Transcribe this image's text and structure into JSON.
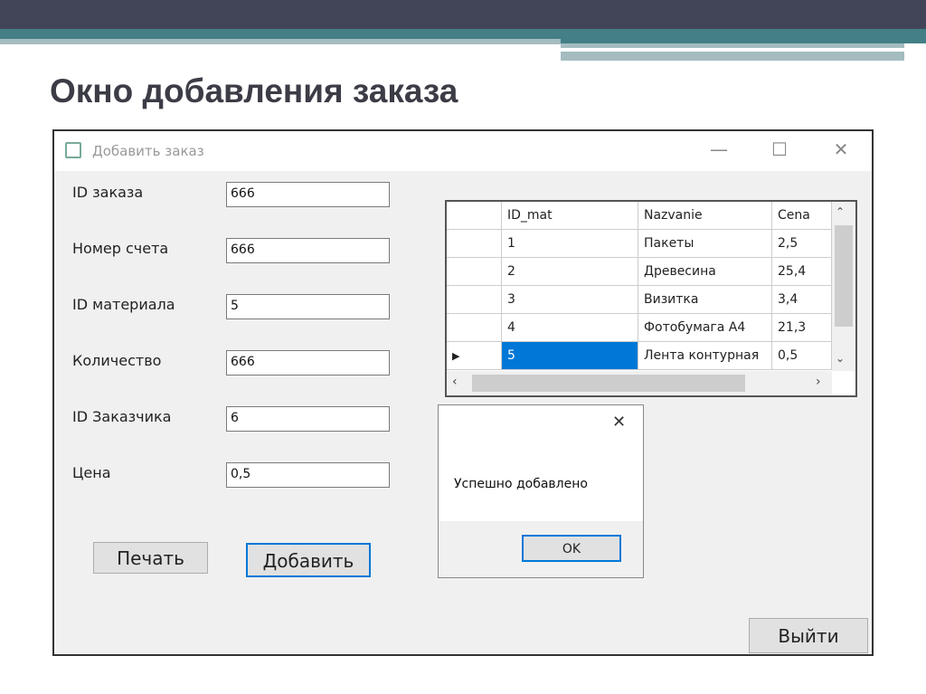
{
  "slide": {
    "title": "Окно добавления заказа"
  },
  "window": {
    "title": "Добавить заказ",
    "minimize": "—",
    "maximize": "☐",
    "close": "✕"
  },
  "form": {
    "fields": [
      {
        "label": "ID заказа",
        "value": "666"
      },
      {
        "label": "Номер счета",
        "value": "666"
      },
      {
        "label": "ID материала",
        "value": "5"
      },
      {
        "label": "Количество",
        "value": "666"
      },
      {
        "label": "ID Заказчика",
        "value": "6"
      },
      {
        "label": "Цена",
        "value": "0,5"
      }
    ],
    "print_label": "Печать",
    "add_label": "Добавить",
    "exit_label": "Выйти"
  },
  "grid": {
    "columns": [
      "ID_mat",
      "Nazvanie",
      "Cena"
    ],
    "rows": [
      [
        "1",
        "Пакеты",
        "2,5"
      ],
      [
        "2",
        "Древесина",
        "25,4"
      ],
      [
        "3",
        "Визитка",
        "3,4"
      ],
      [
        "4",
        "Фотобумага А4",
        "21,3"
      ],
      [
        "5",
        "Лента контурная",
        "0,5"
      ]
    ],
    "selected_row": 4,
    "selection_color": "#0078d7"
  },
  "message": {
    "text": "Успешно добавлено",
    "ok_label": "OK",
    "close": "✕"
  }
}
